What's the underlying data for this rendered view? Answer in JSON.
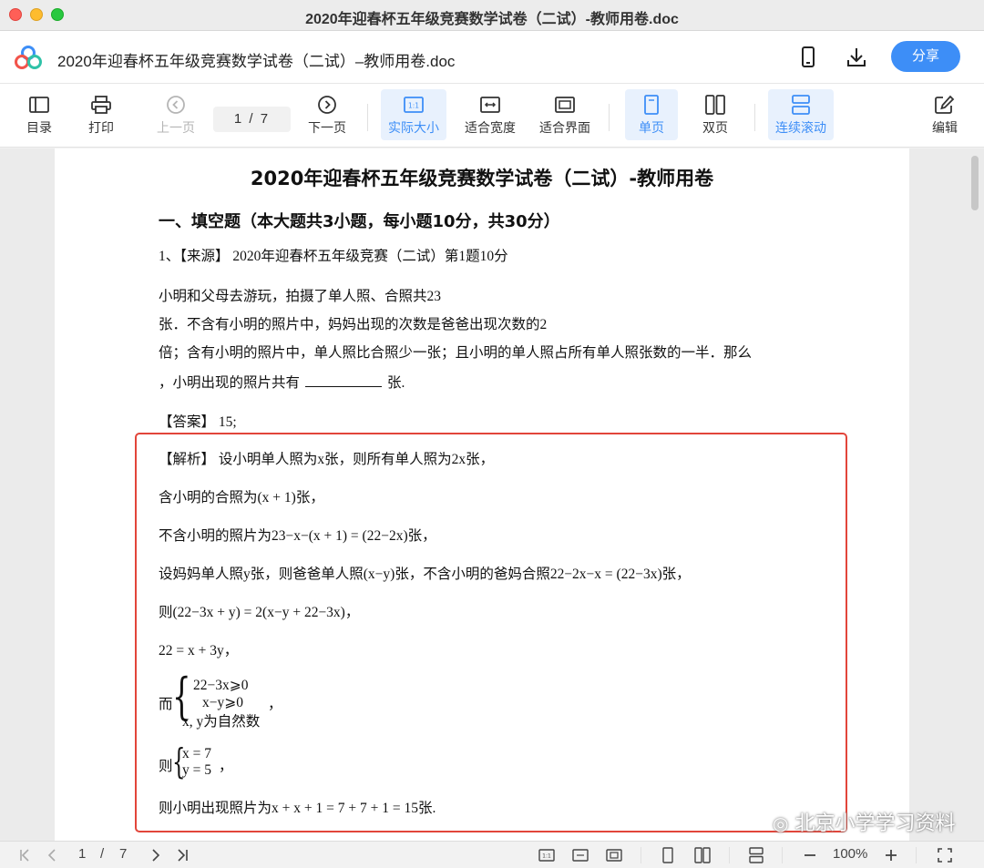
{
  "window": {
    "title": "2020年迎春杯五年级竞赛数学试卷（二试）-教师用卷.doc"
  },
  "header": {
    "doc_title": "2020年迎春杯五年级竞赛数学试卷（二试）–教师用卷.doc",
    "share_label": "分享",
    "icons": [
      "logo-icon",
      "phone-icon",
      "download-icon"
    ]
  },
  "toolbar": {
    "toc": "目录",
    "print": "打印",
    "prev": "上一页",
    "page_display": "1 / 7",
    "next": "下一页",
    "actual_size": "实际大小",
    "fit_width": "适合宽度",
    "fit_screen": "适合界面",
    "single_page": "单页",
    "double_page": "双页",
    "continuous": "连续滚动",
    "edit": "编辑",
    "actual_size_icon_text": "1:1"
  },
  "document": {
    "title": "2020年迎春杯五年级竞赛数学试卷（二试）-教师用卷",
    "section": "一、填空题（本大题共3小题，每小题10分，共30分）",
    "q1_source": "1、【来源】 2020年迎春杯五年级竞赛（二试）第1题10分",
    "q1_lines": [
      "小明和父母去游玩，拍摄了单人照、合照共23",
      "张．不含有小明的照片中，妈妈出现的次数是爸爸出现次数的2",
      "倍；含有小明的照片中，单人照比合照少一张；且小明的单人照占所有单人照张数的一半．那么"
    ],
    "q1_last_prefix": "，小明出现的照片共有",
    "q1_last_suffix": "张.",
    "answer": "【答案】 15;",
    "analysis": [
      "【解析】 设小明单人照为x张，则所有单人照为2x张，",
      "含小明的合照为(x + 1)张，",
      "不含小明的照片为23−x−(x + 1) = (22−2x)张，",
      "设妈妈单人照y张，则爸爸单人照(x−y)张，不含小明的爸妈合照22−2x−x = (22−3x)张，",
      "则(22−3x + y) = 2(x−y + 22−3x)，",
      "22 = x + 3y，"
    ],
    "system1": {
      "prefix": "而",
      "rows": [
        "22−3x⩾0",
        "x−y⩾0",
        "x, y为自然数"
      ],
      "suffix": "，"
    },
    "system2": {
      "prefix": "则",
      "rows": [
        "x = 7",
        "y = 5"
      ],
      "suffix": "，"
    },
    "conclusion": "则小明出现照片为x + x + 1 = 7 + 7 + 1 = 15张."
  },
  "watermark": "北京小学学习资料",
  "statusbar": {
    "page_current": "1",
    "page_sep": "/",
    "page_total": "7",
    "zoom": "100%",
    "actual_size_icon_text": "1:1"
  },
  "colors": {
    "accent": "#3d8ef7",
    "highlight_box": "#e2453a"
  }
}
